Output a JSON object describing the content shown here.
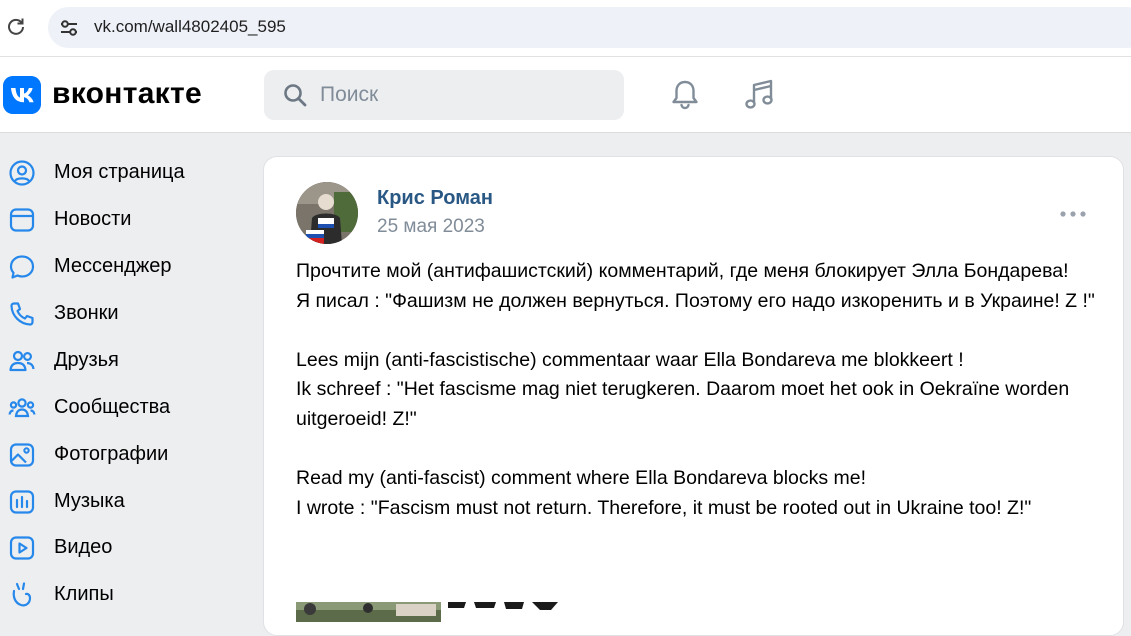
{
  "browser": {
    "url": "vk.com/wall4802405_595"
  },
  "header": {
    "brand": "вконтакте",
    "search_placeholder": "Поиск"
  },
  "sidebar": {
    "items": [
      {
        "label": "Моя страница",
        "icon": "profile-icon"
      },
      {
        "label": "Новости",
        "icon": "news-icon"
      },
      {
        "label": "Мессенджер",
        "icon": "messenger-icon"
      },
      {
        "label": "Звонки",
        "icon": "calls-icon"
      },
      {
        "label": "Друзья",
        "icon": "friends-icon"
      },
      {
        "label": "Сообщества",
        "icon": "communities-icon"
      },
      {
        "label": "Фотографии",
        "icon": "photos-icon"
      },
      {
        "label": "Музыка",
        "icon": "music-icon"
      },
      {
        "label": "Видео",
        "icon": "video-icon"
      },
      {
        "label": "Клипы",
        "icon": "clips-icon"
      }
    ]
  },
  "post": {
    "author": "Крис Роман",
    "date": "25 мая 2023",
    "text_ru_1": "Прочтите мой (антифашистский) комментарий, где меня блокирует Элла Бондарева!",
    "text_ru_2": "Я писал : \"Фашизм не должен вернуться. Поэтому его надо изкоренить и в Украине! Z !\"",
    "text_nl_1": "Lees mijn (anti-fascistische) commentaar waar Ella Bondareva me blokkeert !",
    "text_nl_2": "Ik schreef : \"Het fascisme mag niet terugkeren. Daarom moet het ook in Oekraïne worden uitgeroeid! Z!\"",
    "text_en_1": "Read my (anti-fascist) comment where Ella Bondareva blocks me!",
    "text_en_2": "I wrote : \"Fascism must not return. Therefore, it must be rooted out in Ukraine too! Z!\""
  },
  "colors": {
    "vk_blue": "#0077ff",
    "link_blue": "#2a5885",
    "icon_blue": "#2688eb",
    "muted": "#818c99",
    "page_bg": "#edeef0"
  }
}
